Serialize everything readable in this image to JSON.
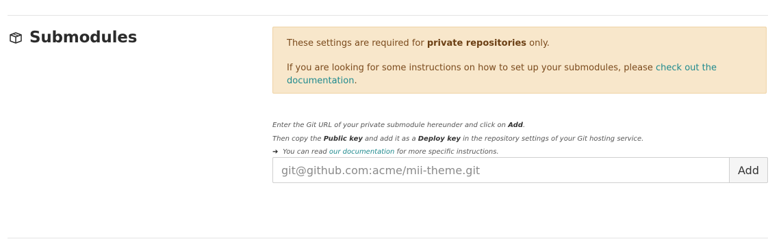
{
  "section": {
    "title": "Submodules",
    "icon": "package-icon"
  },
  "notice": {
    "line1_before": "These settings are required for ",
    "line1_strong": "private repositories",
    "line1_after": " only.",
    "line2_before": "If you are looking for some instructions on how to set up your submodules, please ",
    "line2_link": "check out the documentation",
    "line2_after": "."
  },
  "help": {
    "line1_before": "Enter the Git URL of your private submodule hereunder and click on ",
    "line1_strong": "Add",
    "line1_after": ".",
    "line2_a": "Then copy the ",
    "line2_strong1": "Public key",
    "line2_b": " and add it as a ",
    "line2_strong2": "Deploy key",
    "line2_c": " in the repository settings of your Git hosting service.",
    "line3_arrow": "➔",
    "line3_before": " You can read ",
    "line3_link": "our documentation",
    "line3_after": " for more specific instructions."
  },
  "form": {
    "placeholder": "git@github.com:acme/mii-theme.git",
    "value": "",
    "add_label": "Add"
  },
  "colors": {
    "notice_background": "#f8e7cb",
    "link": "#1f8a8e",
    "notice_text": "#7a4a1c"
  }
}
